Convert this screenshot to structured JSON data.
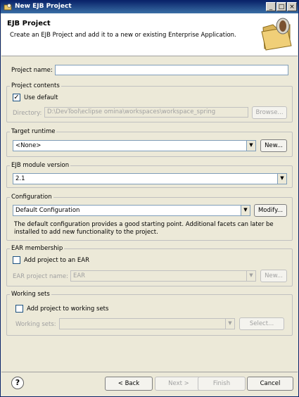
{
  "window": {
    "title": "New EJB Project"
  },
  "header": {
    "title": "EJB Project",
    "description": "Create an EJB Project and add it to a new or existing Enterprise Application."
  },
  "project_name": {
    "label": "Project name:",
    "value": ""
  },
  "contents": {
    "group_label": "Project contents",
    "use_default_label": "Use default",
    "use_default_checked": true,
    "directory_label": "Directory:",
    "directory_value": "D:\\DevTool\\eclipse omina\\workspaces\\workspace_spring",
    "browse_label": "Browse..."
  },
  "target_runtime": {
    "group_label": "Target runtime",
    "selected": "<None>",
    "new_label": "New..."
  },
  "ejb_version": {
    "group_label": "EJB module version",
    "selected": "2.1"
  },
  "configuration": {
    "group_label": "Configuration",
    "selected": "Default Configuration",
    "modify_label": "Modify...",
    "description": "The default configuration provides a good starting point. Additional facets can later be installed to add new functionality to the project."
  },
  "ear": {
    "group_label": "EAR membership",
    "add_label": "Add project to an EAR",
    "checked": false,
    "name_label": "EAR project name:",
    "name_value": "EAR",
    "new_label": "New..."
  },
  "working_sets": {
    "group_label": "Working sets",
    "add_label": "Add project to working sets",
    "checked": false,
    "sets_label": "Working sets:",
    "sets_value": "",
    "select_label": "Select..."
  },
  "footer": {
    "back": "< Back",
    "next": "Next >",
    "finish": "Finish",
    "cancel": "Cancel"
  },
  "icons": {
    "app": "eclipse-icon",
    "minimize": "minimize-icon",
    "maximize": "maximize-icon",
    "close": "close-icon",
    "wizard": "folder-bean-icon",
    "help": "help-icon"
  }
}
